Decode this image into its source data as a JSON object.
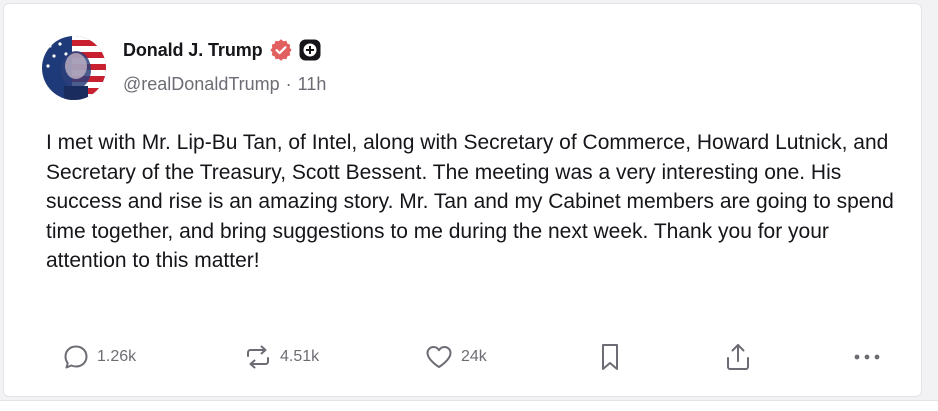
{
  "post": {
    "display_name": "Donald J. Trump",
    "handle": "@realDonaldTrump",
    "separator": "·",
    "time_ago": "11h",
    "body": "I met with Mr. Lip-Bu Tan, of Intel, along with Secretary of Commerce, Howard Lutnick, and Secretary of the Treasury, Scott Bessent. The meeting was a very interesting one. His success and rise is an amazing story. Mr. Tan and my Cabinet members are going to spend time together, and bring suggestions to me during the next week. Thank you for your attention to this matter!"
  },
  "actions": {
    "replies": "1.26k",
    "reposts": "4.51k",
    "likes": "24k"
  },
  "icons": {
    "verified": "verified-badge-icon",
    "plus_badge": "plus-badge-icon",
    "reply": "reply-icon",
    "repost": "repost-icon",
    "like": "heart-icon",
    "bookmark": "bookmark-icon",
    "share": "share-icon",
    "more": "more-icon"
  },
  "colors": {
    "verified_badge": "#e15f5f",
    "text_primary": "#15151a",
    "text_secondary": "#6c6c74"
  }
}
